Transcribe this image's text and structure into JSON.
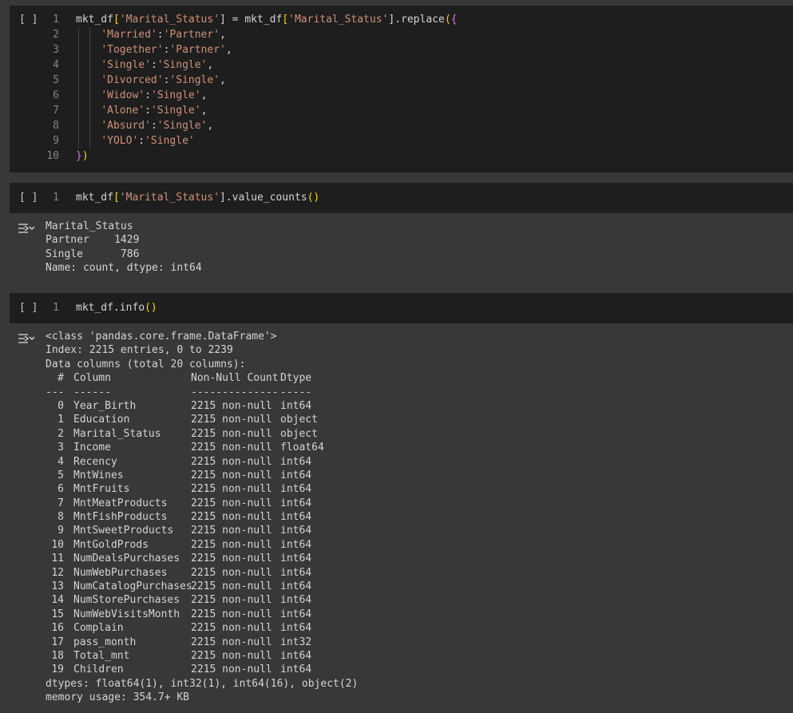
{
  "cells": [
    {
      "run_label": "[ ]",
      "lines": [
        {
          "n": "1",
          "parts": [
            [
              "mkt_df",
              ""
            ],
            [
              "[",
              "br1"
            ],
            [
              "'Marital_Status'",
              "str"
            ],
            [
              "]",
              ""
            ],
            [
              " = mkt_df",
              ""
            ],
            [
              "[",
              "br1"
            ],
            [
              "'Marital_Status'",
              "str"
            ],
            [
              "]",
              ""
            ],
            [
              ".replace",
              ""
            ],
            [
              "(",
              "br1"
            ],
            [
              "{",
              "br2"
            ]
          ]
        },
        {
          "n": "2",
          "parts": [
            [
              "    ",
              ""
            ],
            [
              "'Married'",
              "str"
            ],
            [
              ":",
              ""
            ],
            [
              "'Partner'",
              "str"
            ],
            [
              ",",
              ""
            ]
          ]
        },
        {
          "n": "3",
          "parts": [
            [
              "    ",
              ""
            ],
            [
              "'Together'",
              "str"
            ],
            [
              ":",
              ""
            ],
            [
              "'Partner'",
              "str"
            ],
            [
              ",",
              ""
            ]
          ]
        },
        {
          "n": "4",
          "parts": [
            [
              "    ",
              ""
            ],
            [
              "'Single'",
              "str"
            ],
            [
              ":",
              ""
            ],
            [
              "'Single'",
              "str"
            ],
            [
              ",",
              ""
            ]
          ]
        },
        {
          "n": "5",
          "parts": [
            [
              "    ",
              ""
            ],
            [
              "'Divorced'",
              "str"
            ],
            [
              ":",
              ""
            ],
            [
              "'Single'",
              "str"
            ],
            [
              ",",
              ""
            ]
          ]
        },
        {
          "n": "6",
          "parts": [
            [
              "    ",
              ""
            ],
            [
              "'Widow'",
              "str"
            ],
            [
              ":",
              ""
            ],
            [
              "'Single'",
              "str"
            ],
            [
              ",",
              ""
            ]
          ]
        },
        {
          "n": "7",
          "parts": [
            [
              "    ",
              ""
            ],
            [
              "'Alone'",
              "str"
            ],
            [
              ":",
              ""
            ],
            [
              "'Single'",
              "str"
            ],
            [
              ",",
              ""
            ]
          ]
        },
        {
          "n": "8",
          "parts": [
            [
              "    ",
              ""
            ],
            [
              "'Absurd'",
              "str"
            ],
            [
              ":",
              ""
            ],
            [
              "'Single'",
              "str"
            ],
            [
              ",",
              ""
            ]
          ]
        },
        {
          "n": "9",
          "parts": [
            [
              "    ",
              ""
            ],
            [
              "'YOLO'",
              "str"
            ],
            [
              ":",
              ""
            ],
            [
              "'Single'",
              "str"
            ]
          ]
        },
        {
          "n": "10",
          "parts": [
            [
              "}",
              "br2"
            ],
            [
              ")",
              "br1"
            ]
          ]
        }
      ]
    },
    {
      "run_label": "[ ]",
      "lines": [
        {
          "n": "1",
          "parts": [
            [
              "mkt_df",
              ""
            ],
            [
              "[",
              "br1"
            ],
            [
              "'Marital_Status'",
              "str"
            ],
            [
              "]",
              ""
            ],
            [
              ".value_counts",
              ""
            ],
            [
              "()",
              "br1"
            ]
          ]
        }
      ],
      "output": [
        "Marital_Status",
        "Partner    1429",
        "Single      786",
        "Name: count, dtype: int64"
      ]
    },
    {
      "run_label": "[ ]",
      "lines": [
        {
          "n": "1",
          "parts": [
            [
              "mkt_df.info",
              ""
            ],
            [
              "()",
              "br1"
            ]
          ]
        }
      ],
      "output_head": [
        "<class 'pandas.core.frame.DataFrame'>",
        "Index: 2215 entries, 0 to 2239",
        "Data columns (total 20 columns):"
      ],
      "table_header": {
        "idx": "#",
        "col": "Column",
        "nn": "Non-Null Count",
        "dt": "Dtype"
      },
      "table_rule": {
        "idx": "---",
        "col": "------",
        "nn": "--------------",
        "dt": "-----"
      },
      "rows": [
        {
          "idx": "0",
          "col": "Year_Birth",
          "nn": "2215 non-null",
          "dt": "int64"
        },
        {
          "idx": "1",
          "col": "Education",
          "nn": "2215 non-null",
          "dt": "object"
        },
        {
          "idx": "2",
          "col": "Marital_Status",
          "nn": "2215 non-null",
          "dt": "object"
        },
        {
          "idx": "3",
          "col": "Income",
          "nn": "2215 non-null",
          "dt": "float64"
        },
        {
          "idx": "4",
          "col": "Recency",
          "nn": "2215 non-null",
          "dt": "int64"
        },
        {
          "idx": "5",
          "col": "MntWines",
          "nn": "2215 non-null",
          "dt": "int64"
        },
        {
          "idx": "6",
          "col": "MntFruits",
          "nn": "2215 non-null",
          "dt": "int64"
        },
        {
          "idx": "7",
          "col": "MntMeatProducts",
          "nn": "2215 non-null",
          "dt": "int64"
        },
        {
          "idx": "8",
          "col": "MntFishProducts",
          "nn": "2215 non-null",
          "dt": "int64"
        },
        {
          "idx": "9",
          "col": "MntSweetProducts",
          "nn": "2215 non-null",
          "dt": "int64"
        },
        {
          "idx": "10",
          "col": "MntGoldProds",
          "nn": "2215 non-null",
          "dt": "int64"
        },
        {
          "idx": "11",
          "col": "NumDealsPurchases",
          "nn": "2215 non-null",
          "dt": "int64"
        },
        {
          "idx": "12",
          "col": "NumWebPurchases",
          "nn": "2215 non-null",
          "dt": "int64"
        },
        {
          "idx": "13",
          "col": "NumCatalogPurchases",
          "nn": "2215 non-null",
          "dt": "int64"
        },
        {
          "idx": "14",
          "col": "NumStorePurchases",
          "nn": "2215 non-null",
          "dt": "int64"
        },
        {
          "idx": "15",
          "col": "NumWebVisitsMonth",
          "nn": "2215 non-null",
          "dt": "int64"
        },
        {
          "idx": "16",
          "col": "Complain",
          "nn": "2215 non-null",
          "dt": "int64"
        },
        {
          "idx": "17",
          "col": "pass_month",
          "nn": "2215 non-null",
          "dt": "int32"
        },
        {
          "idx": "18",
          "col": "Total_mnt",
          "nn": "2215 non-null",
          "dt": "int64"
        },
        {
          "idx": "19",
          "col": "Children",
          "nn": "2215 non-null",
          "dt": "int64"
        }
      ],
      "output_tail": [
        "dtypes: float64(1), int32(1), int64(16), object(2)",
        "memory usage: 354.7+ KB"
      ]
    }
  ],
  "icons": {
    "run": "run-cell-button",
    "output": "output-toggle-icon"
  }
}
